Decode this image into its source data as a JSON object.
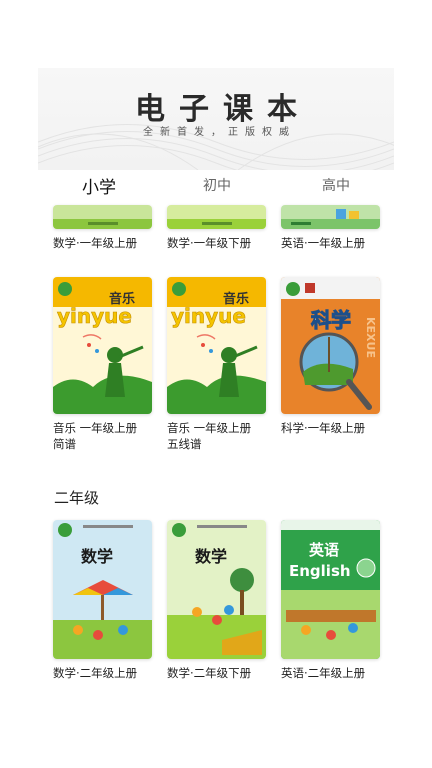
{
  "banner": {
    "title": "电子课本",
    "subtitle": "全新首发，正版权威"
  },
  "tabs": [
    {
      "label": "小学",
      "active": true
    },
    {
      "label": "初中",
      "active": false
    },
    {
      "label": "高中",
      "active": false
    }
  ],
  "row_top": {
    "books": [
      {
        "title": "数学·一年级上册"
      },
      {
        "title": "数学·一年级下册"
      },
      {
        "title": "英语·一年级上册"
      }
    ]
  },
  "row_music": {
    "books": [
      {
        "title_line1": "音乐 一年级上册",
        "title_line2": "简谱",
        "cover_text": "音乐",
        "cover_pinyin": "yinyue"
      },
      {
        "title_line1": "音乐 一年级上册",
        "title_line2": "五线谱",
        "cover_text": "音乐",
        "cover_pinyin": "yinyue"
      },
      {
        "title_line1": "科学·一年级上册",
        "title_line2": "",
        "cover_text": "科学",
        "cover_pinyin": "KEXUE"
      }
    ]
  },
  "section_grade2": {
    "header": "二年级",
    "books": [
      {
        "title": "数学·二年级上册",
        "cover_text": "数学"
      },
      {
        "title": "数学·二年级下册",
        "cover_text": "数学"
      },
      {
        "title": "英语·二年级上册",
        "cover_text": "英语",
        "cover_text_en": "English"
      }
    ]
  },
  "colors": {
    "math_green": "#8cc63f",
    "music_yellow": "#f5b800",
    "science_orange": "#e8832a",
    "english_green": "#2fa24a"
  }
}
